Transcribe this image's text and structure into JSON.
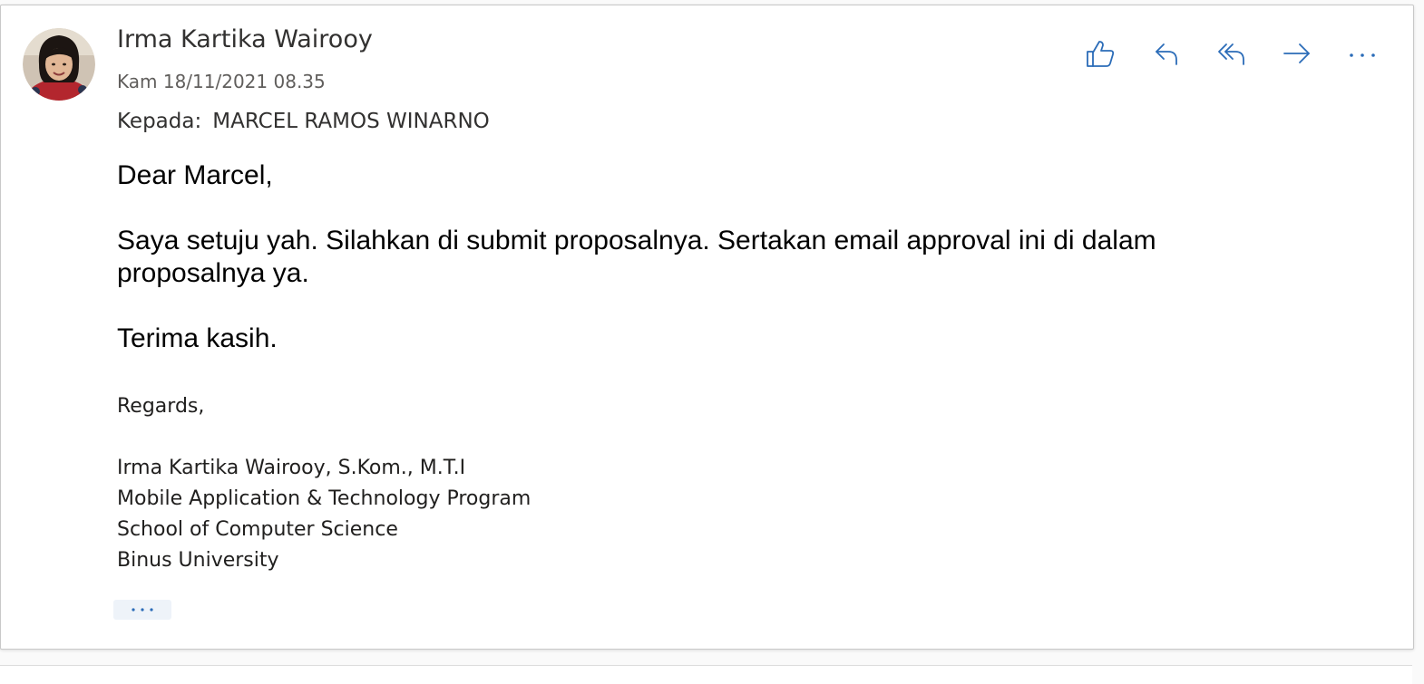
{
  "message": {
    "sender_name": "Irma Kartika Wairooy",
    "datetime": "Kam 18/11/2021 08.35",
    "to_label": "Kepada:",
    "to_value": "MARCEL RAMOS WINARNO"
  },
  "actions": [
    {
      "name": "like-icon"
    },
    {
      "name": "reply-icon"
    },
    {
      "name": "reply-all-icon"
    },
    {
      "name": "forward-icon"
    },
    {
      "name": "more-actions-icon"
    }
  ],
  "body": {
    "greeting": "Dear Marcel,",
    "paragraph": "Saya setuju yah. Silahkan di submit proposalnya. Sertakan email approval ini di dalam proposalnya ya.",
    "closing": "Terima kasih."
  },
  "signature": {
    "regards": "Regards,",
    "lines": [
      "Irma Kartika Wairooy, S.Kom., M.T.I",
      "Mobile Application & Technology Program",
      "School of Computer Science",
      "Binus University"
    ]
  },
  "colors": {
    "accent": "#2b6cb8",
    "text_primary": "#323130",
    "text_secondary": "#605e5c"
  }
}
